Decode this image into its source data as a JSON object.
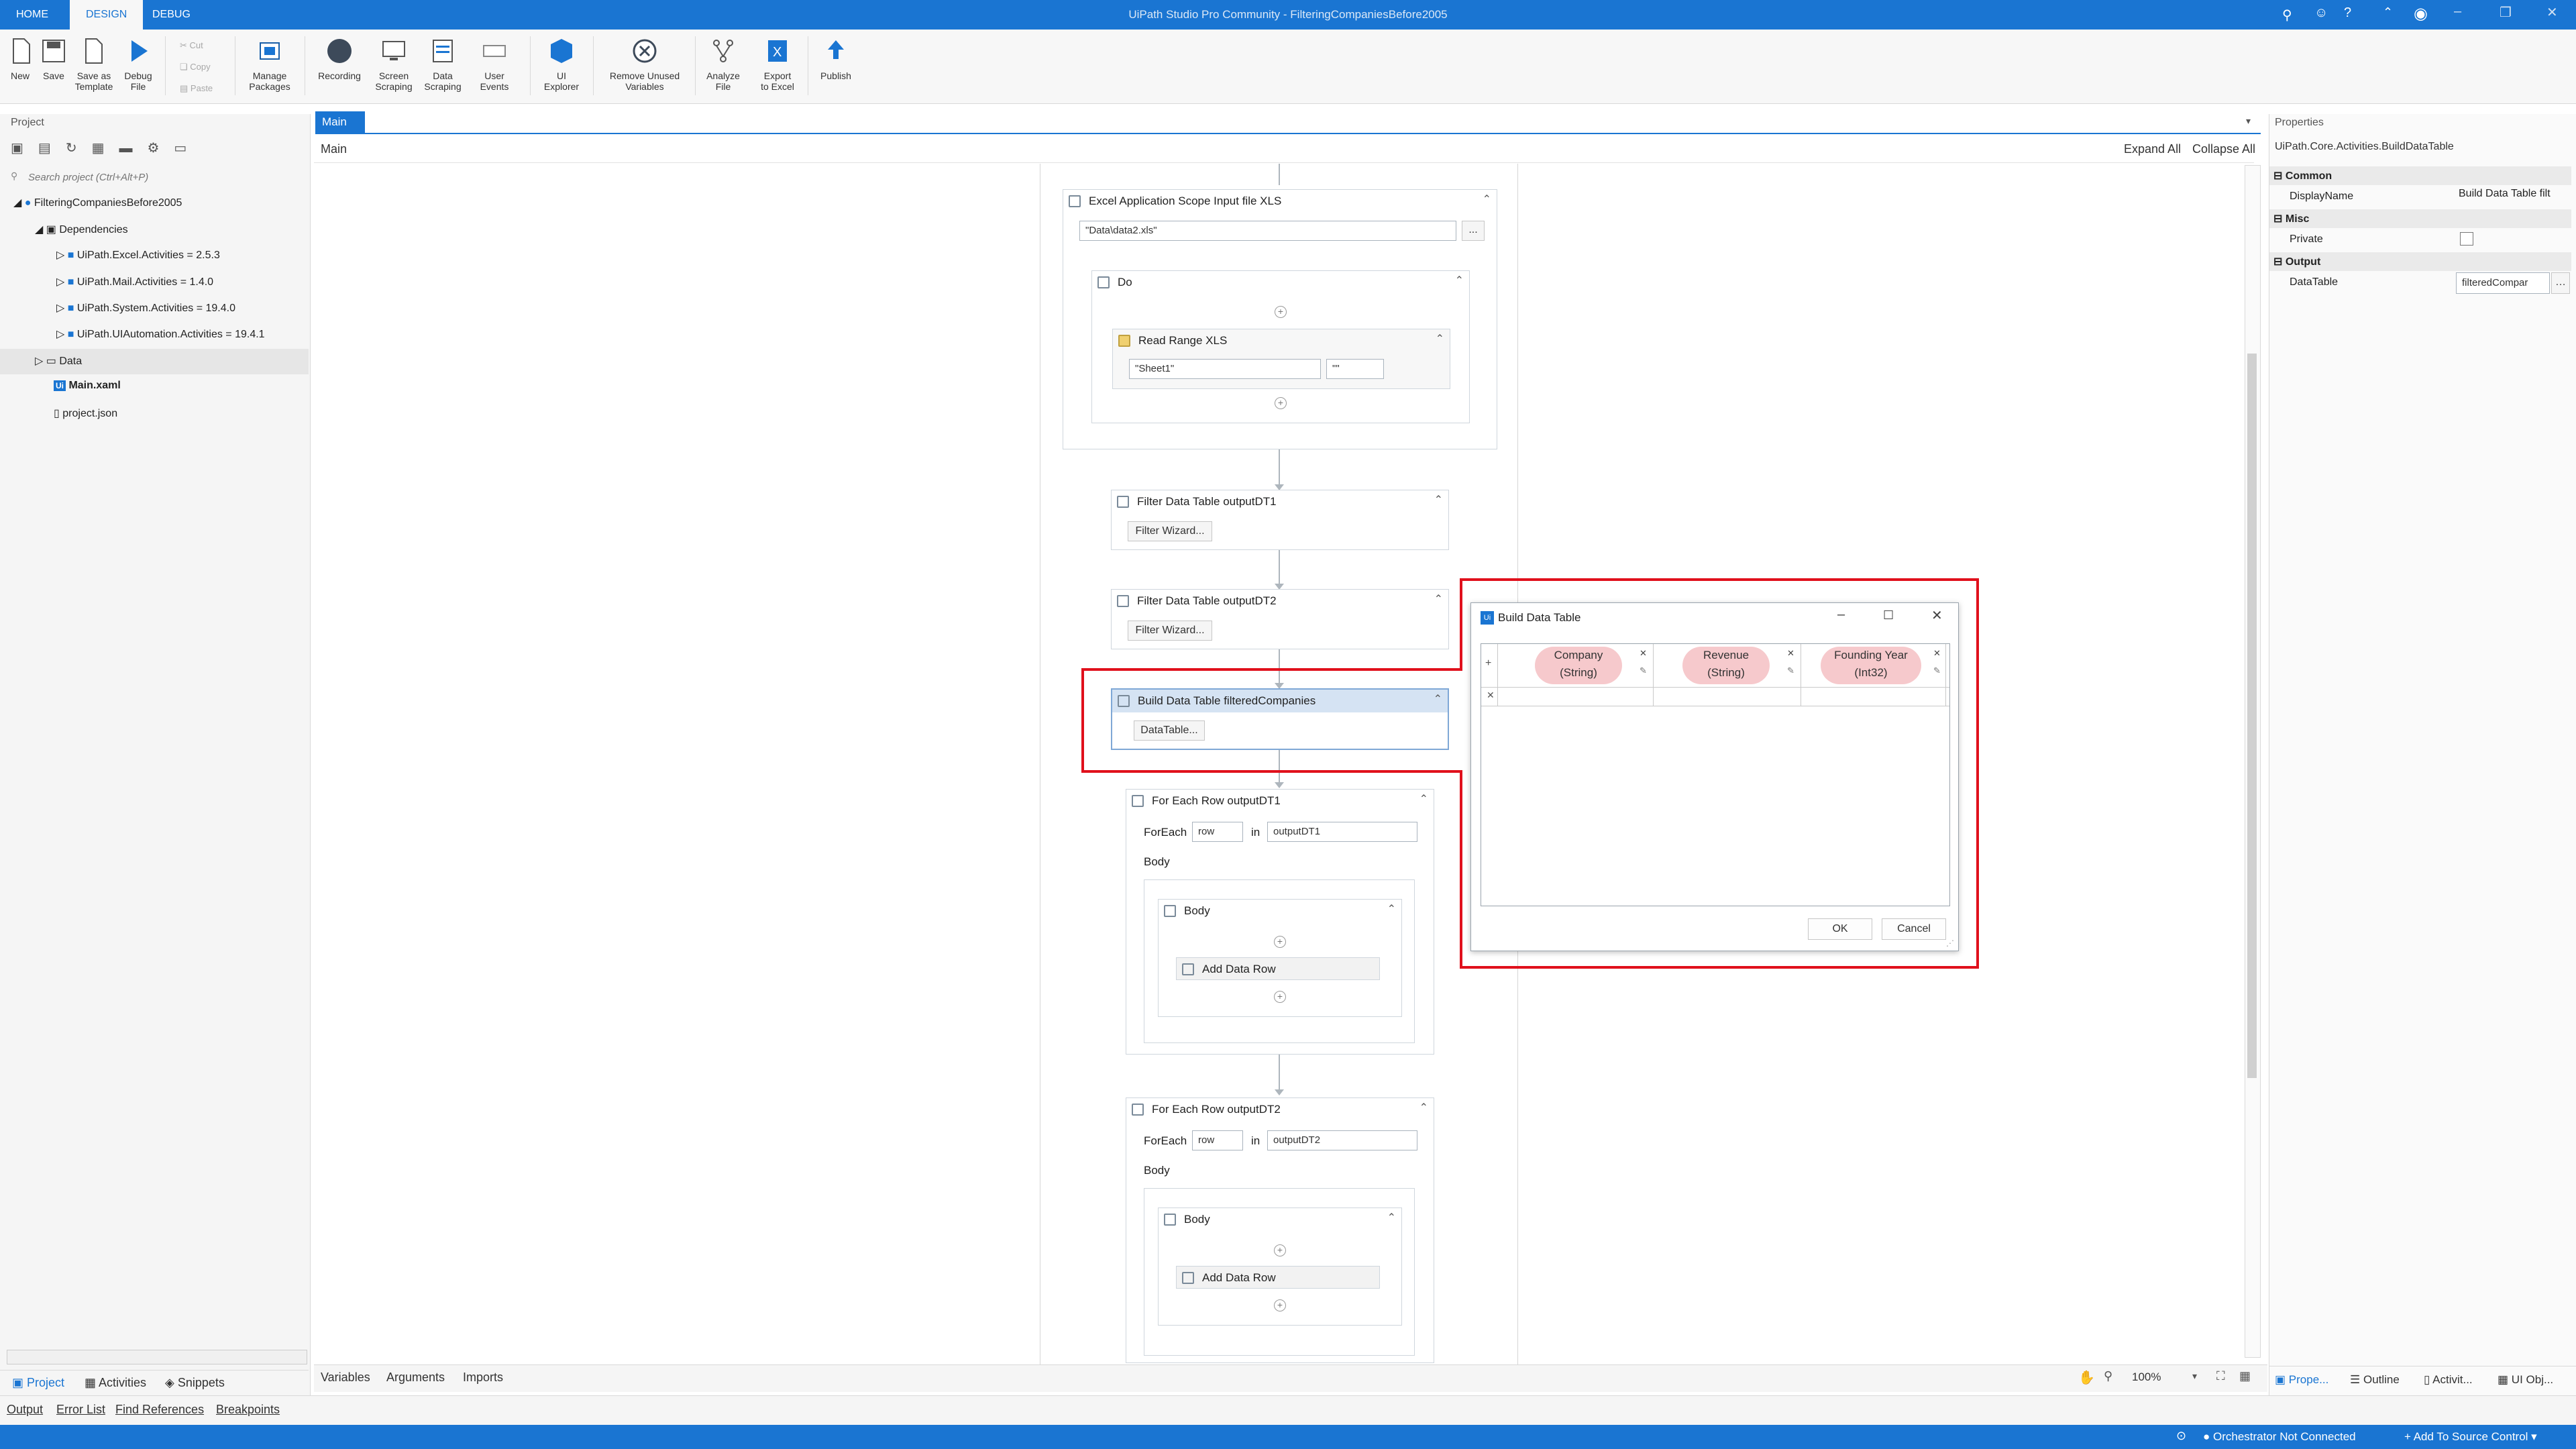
{
  "titlebar": {
    "tabs": [
      "HOME",
      "DESIGN",
      "DEBUG"
    ],
    "title": "UiPath Studio Pro Community - FilteringCompaniesBefore2005"
  },
  "ribbon": {
    "new": "New",
    "save": "Save",
    "save_template": [
      "Save as",
      "Template"
    ],
    "debug": [
      "Debug",
      "File"
    ],
    "cut": "Cut",
    "copy": "Copy",
    "paste": "Paste",
    "manage_packages": [
      "Manage",
      "Packages"
    ],
    "recording": "Recording",
    "screen_scraping": [
      "Screen",
      "Scraping"
    ],
    "data_scraping": [
      "Data",
      "Scraping"
    ],
    "user_events": [
      "User",
      "Events"
    ],
    "ui_explorer": [
      "UI",
      "Explorer"
    ],
    "remove_unused": [
      "Remove Unused",
      "Variables"
    ],
    "analyze_file": [
      "Analyze",
      "File"
    ],
    "export_excel": [
      "Export",
      "to Excel"
    ],
    "publish": "Publish"
  },
  "project": {
    "title": "Project",
    "search_placeholder": "Search project (Ctrl+Alt+P)",
    "root": "FilteringCompaniesBefore2005",
    "dependencies": "Dependencies",
    "deps": [
      "UiPath.Excel.Activities = 2.5.3",
      "UiPath.Mail.Activities = 1.4.0",
      "UiPath.System.Activities = 19.4.0",
      "UiPath.UIAutomation.Activities = 19.4.1"
    ],
    "data_folder": "Data",
    "main_file": "Main.xaml",
    "project_json": "project.json",
    "bottom_tabs": [
      "Project",
      "Activities",
      "Snippets"
    ]
  },
  "designer": {
    "tab": "Main",
    "breadcrumb": "Main",
    "expand_all": "Expand All",
    "collapse_all": "Collapse All",
    "excel_scope": {
      "title": "Excel Application Scope Input file XLS",
      "path": "\"Data\\data2.xls\"",
      "browse": "...",
      "do": "Do",
      "read_range": "Read Range XLS",
      "sheet": "\"Sheet1\"",
      "range": "\"\""
    },
    "filter1": {
      "title": "Filter Data Table outputDT1",
      "button": "Filter Wizard..."
    },
    "filter2": {
      "title": "Filter Data Table outputDT2",
      "button": "Filter Wizard..."
    },
    "build": {
      "title": "Build Data Table filteredCompanies",
      "button": "DataTable..."
    },
    "foreach1": {
      "title": "For Each Row outputDT1",
      "foreach": "ForEach",
      "var": "row",
      "in": "in",
      "collection": "outputDT1",
      "body": "Body",
      "inner_body": "Body",
      "add_row": "Add Data Row"
    },
    "foreach2": {
      "title": "For Each Row outputDT2",
      "foreach": "ForEach",
      "var": "row",
      "in": "in",
      "collection": "outputDT2",
      "body": "Body",
      "inner_body": "Body",
      "add_row": "Add Data Row"
    },
    "bottom_tabs": [
      "Variables",
      "Arguments",
      "Imports"
    ],
    "zoom": "100%"
  },
  "dialog": {
    "title": "Build Data Table",
    "columns": [
      {
        "name": "Company",
        "type": "(String)"
      },
      {
        "name": "Revenue",
        "type": "(String)"
      },
      {
        "name": "Founding Year",
        "type": "(Int32)"
      }
    ],
    "ok": "OK",
    "cancel": "Cancel"
  },
  "properties": {
    "title": "Properties",
    "activity": "UiPath.Core.Activities.BuildDataTable",
    "common": "Common",
    "display_name_label": "DisplayName",
    "display_name_value": "Build Data Table filt",
    "misc": "Misc",
    "private_label": "Private",
    "output": "Output",
    "datatable_label": "DataTable",
    "datatable_value": "filteredCompar",
    "bottom_tabs": [
      "Prope...",
      "Outline",
      "Activit...",
      "UI Obj..."
    ]
  },
  "output_tabs": [
    "Output",
    "Error List",
    "Find References",
    "Breakpoints"
  ],
  "status": {
    "orchestrator": "Orchestrator Not Connected",
    "source_control": "Add To Source Control"
  },
  "colors": {
    "accent": "#1a75d2",
    "highlight_red": "#e0101c"
  }
}
